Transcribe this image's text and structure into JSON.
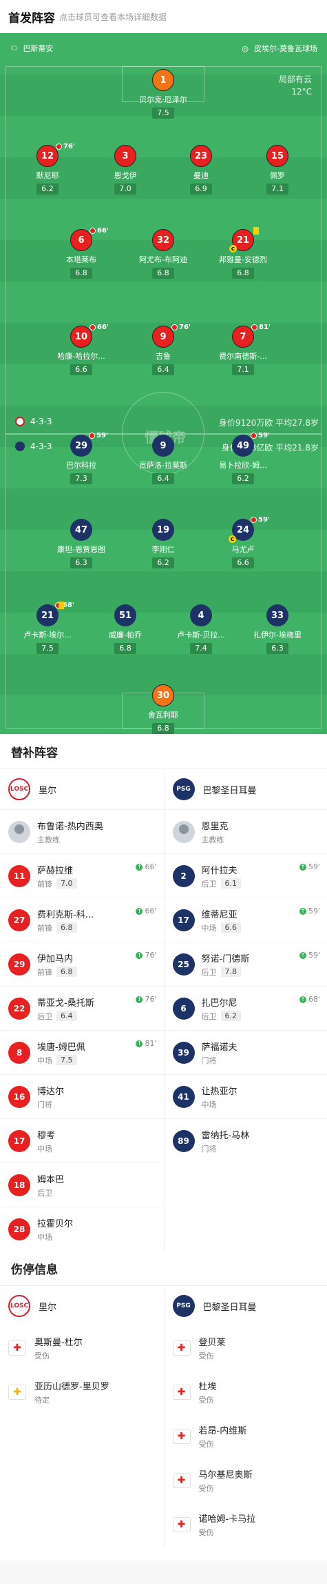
{
  "header": {
    "title": "首发阵容",
    "subtitle": "点击球员可查看本场详细数据"
  },
  "venue": {
    "referee": "巴斯蒂安",
    "stadium": "皮埃尔-莫鲁瓦球场"
  },
  "weather": {
    "desc": "局部有云",
    "temp": "12°C"
  },
  "watermark": "懂球帝",
  "home": {
    "name": "里尔",
    "formation": "4-3-3",
    "value": "身价9120万欧",
    "age": "平均27.8岁",
    "players": [
      {
        "no": "1",
        "name": "贝尔克·厄泽尔",
        "rating": "7.5",
        "pos": "gk"
      },
      {
        "no": "12",
        "name": "默尼耶",
        "rating": "6.2",
        "sub": "76'"
      },
      {
        "no": "3",
        "name": "恩戈伊",
        "rating": "7.0"
      },
      {
        "no": "23",
        "name": "曼迪",
        "rating": "6.9"
      },
      {
        "no": "15",
        "name": "佩罗",
        "rating": "7.1"
      },
      {
        "no": "6",
        "name": "本塔莱布",
        "rating": "6.8",
        "sub": "66'"
      },
      {
        "no": "32",
        "name": "阿尤布-布阿迪",
        "rating": "6.8"
      },
      {
        "no": "21",
        "name": "邦雅曼-安德烈",
        "rating": "6.8",
        "card": "yellow",
        "captain": "C"
      },
      {
        "no": "10",
        "name": "哈康-哈拉尔...",
        "rating": "6.6",
        "sub": "66'"
      },
      {
        "no": "9",
        "name": "吉鲁",
        "rating": "6.4",
        "sub": "76'"
      },
      {
        "no": "7",
        "name": "费尔南德斯-...",
        "rating": "7.1",
        "sub": "81'"
      }
    ]
  },
  "away": {
    "name": "巴黎圣日耳曼",
    "formation": "4-3-3",
    "value": "身价3.53亿欧",
    "age": "平均21.8岁",
    "players": [
      {
        "no": "29",
        "name": "巴尔科拉",
        "rating": "7.3",
        "sub": "59'"
      },
      {
        "no": "9",
        "name": "贡萨洛-拉莫斯",
        "rating": "6.4"
      },
      {
        "no": "49",
        "name": "易卜拉欣-姆...",
        "rating": "6.2",
        "sub": "59'"
      },
      {
        "no": "47",
        "name": "康坦-恩贾恩图",
        "rating": "6.3"
      },
      {
        "no": "19",
        "name": "李刚仁",
        "rating": "6.2"
      },
      {
        "no": "24",
        "name": "马尤卢",
        "rating": "6.6",
        "sub": "59'",
        "captain": "C"
      },
      {
        "no": "21",
        "name": "卢卡斯-埃尔...",
        "rating": "7.5",
        "sub": "68'",
        "card": "yellow"
      },
      {
        "no": "51",
        "name": "威廉-帕乔",
        "rating": "6.8"
      },
      {
        "no": "4",
        "name": "卢卡斯-贝拉...",
        "rating": "7.4"
      },
      {
        "no": "33",
        "name": "扎伊尔-埃梅里",
        "rating": "6.3"
      },
      {
        "no": "30",
        "name": "舍瓦利耶",
        "rating": "6.8",
        "pos": "gk"
      }
    ]
  },
  "subs": {
    "title": "替补阵容",
    "home": {
      "team": "里尔",
      "coach": {
        "name": "布鲁诺-热内西奥",
        "role": "主教练"
      },
      "list": [
        {
          "no": "11",
          "name": "萨赫拉维",
          "pos": "前锋",
          "rating": "7.0",
          "event": "66'"
        },
        {
          "no": "27",
          "name": "费利克斯-科...",
          "pos": "前锋",
          "rating": "6.8",
          "event": "66'"
        },
        {
          "no": "29",
          "name": "伊加马内",
          "pos": "前锋",
          "rating": "6.8",
          "event": "76'"
        },
        {
          "no": "22",
          "name": "蒂亚戈-桑托斯",
          "pos": "后卫",
          "rating": "6.4",
          "event": "76'"
        },
        {
          "no": "8",
          "name": "埃唐-姆巴佩",
          "pos": "中场",
          "rating": "7.5",
          "event": "81'"
        },
        {
          "no": "16",
          "name": "博达尔",
          "pos": "门将"
        },
        {
          "no": "17",
          "name": "穆考",
          "pos": "中场"
        },
        {
          "no": "18",
          "name": "姆本巴",
          "pos": "后卫"
        },
        {
          "no": "28",
          "name": "拉霍贝尔",
          "pos": "中场"
        }
      ]
    },
    "away": {
      "team": "巴黎圣日耳曼",
      "coach": {
        "name": "恩里克",
        "role": "主教练"
      },
      "list": [
        {
          "no": "2",
          "name": "阿什拉夫",
          "pos": "后卫",
          "rating": "6.1",
          "event": "59'"
        },
        {
          "no": "17",
          "name": "维蒂尼亚",
          "pos": "中场",
          "rating": "6.6",
          "event": "59'"
        },
        {
          "no": "25",
          "name": "努诺-门德斯",
          "pos": "后卫",
          "rating": "7.8",
          "event": "59'"
        },
        {
          "no": "6",
          "name": "扎巴尔尼",
          "pos": "后卫",
          "rating": "6.2",
          "event": "68'"
        },
        {
          "no": "39",
          "name": "萨福诺夫",
          "pos": "门将"
        },
        {
          "no": "41",
          "name": "让热亚尔",
          "pos": "中场"
        },
        {
          "no": "89",
          "name": "雷纳托-马林",
          "pos": "门将"
        }
      ]
    }
  },
  "injuries": {
    "title": "伤停信息",
    "home": {
      "team": "里尔",
      "list": [
        {
          "name": "奥斯曼-杜尔",
          "status": "受伤",
          "type": "red"
        },
        {
          "name": "亚历山德罗-里贝罗",
          "status": "待定",
          "type": "yellow"
        }
      ]
    },
    "away": {
      "team": "巴黎圣日耳曼",
      "list": [
        {
          "name": "登贝莱",
          "status": "受伤",
          "type": "red"
        },
        {
          "name": "杜埃",
          "status": "受伤",
          "type": "red"
        },
        {
          "name": "若昂-内维斯",
          "status": "受伤",
          "type": "red"
        },
        {
          "name": "马尔基尼奥斯",
          "status": "受伤",
          "type": "red"
        },
        {
          "name": "诺哈姆-卡马拉",
          "status": "受伤",
          "type": "red"
        }
      ]
    }
  },
  "colors": {
    "pitch": "#40b266",
    "home": "#e8201f",
    "away": "#1d3366",
    "gk": "#f47318"
  }
}
